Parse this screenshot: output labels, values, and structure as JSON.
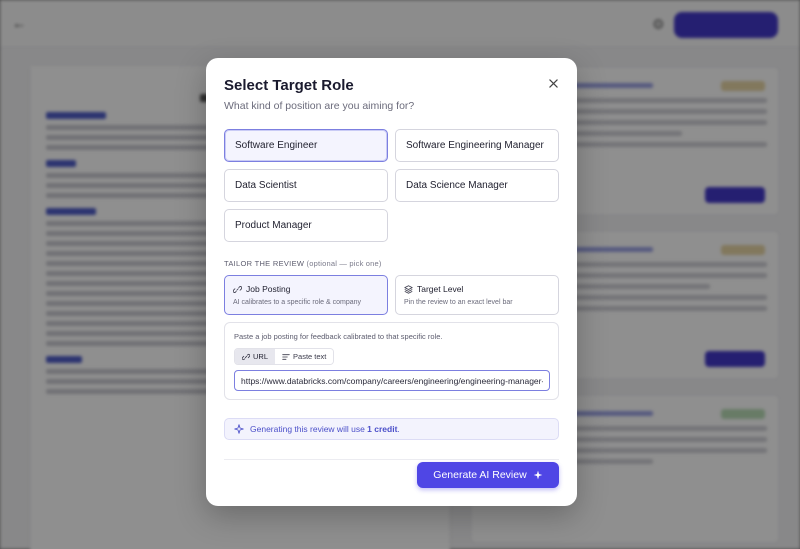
{
  "modal": {
    "title": "Select Target Role",
    "subtitle": "What kind of position are you aiming for?",
    "roles": [
      {
        "label": "Software Engineer",
        "selected": true
      },
      {
        "label": "Software Engineering Manager",
        "selected": false
      },
      {
        "label": "Data Scientist",
        "selected": false
      },
      {
        "label": "Data Science Manager",
        "selected": false
      },
      {
        "label": "Product Manager",
        "selected": false
      }
    ],
    "tailor": {
      "label": "Tailor the review",
      "note": "(optional — pick one)",
      "options": [
        {
          "title": "Job Posting",
          "desc": "AI calibrates to a specific role & company",
          "icon": "link-icon",
          "selected": true
        },
        {
          "title": "Target Level",
          "desc": "Pin the review to an exact level bar",
          "icon": "layers-icon",
          "selected": false
        }
      ]
    },
    "posting": {
      "hint": "Paste a job posting for feedback calibrated to that specific role.",
      "modes": [
        {
          "label": "URL",
          "icon": "link-icon",
          "active": true
        },
        {
          "label": "Paste text",
          "icon": "text-lines-icon",
          "active": false
        }
      ],
      "url_value": "https://www.databricks.com/company/careers/engineering/engineering-manager-"
    },
    "credit": {
      "prefix": "Generating this review will use ",
      "amount": "1 credit",
      "suffix": ".",
      "icon": "sparkle-icon"
    },
    "generate_label": "Generate AI Review",
    "accent": "#4f46e5"
  }
}
